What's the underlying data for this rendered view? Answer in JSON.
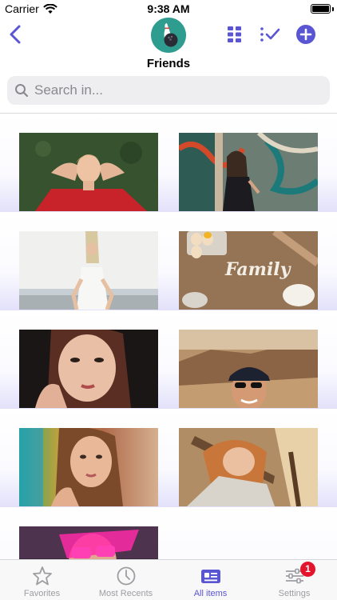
{
  "status_bar": {
    "carrier": "Carrier",
    "time": "9:38 AM"
  },
  "nav": {
    "title": "Friends",
    "icons": [
      "chevron-left-icon",
      "bowling-icon",
      "grid-view-icon",
      "select-check-icon",
      "add-circle-icon"
    ]
  },
  "search": {
    "placeholder": "Search in..."
  },
  "photos": [
    "man-lying-on-grass-photo",
    "woman-graffiti-wall-photo",
    "woman-beach-photo",
    "family-flour-table-photo",
    "woman-portrait-photo",
    "man-cap-sunglasses-photo",
    "woman-rainbow-light-photo",
    "woman-chair-sunlight-photo",
    "woman-pink-glasses-photo"
  ],
  "tabbar": {
    "tabs": [
      {
        "label": "Favorites",
        "icon": "star-icon",
        "active": false
      },
      {
        "label": "Most Recents",
        "icon": "clock-icon",
        "active": false
      },
      {
        "label": "All items",
        "icon": "id-card-icon",
        "active": true
      },
      {
        "label": "Settings",
        "icon": "sliders-icon",
        "active": false,
        "badge": "1"
      }
    ]
  },
  "colors": {
    "accent": "#5a55d2",
    "avatar_bg": "#2e9c8e",
    "badge": "#e4142c",
    "row_gradient_end": "#e3e1fa"
  }
}
